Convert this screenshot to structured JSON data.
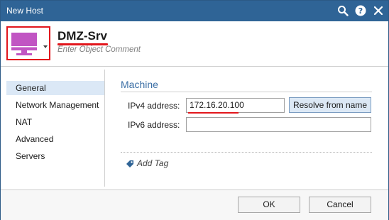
{
  "window": {
    "title": "New Host",
    "icons": [
      "search-icon",
      "help-icon",
      "close-icon"
    ]
  },
  "object": {
    "name": "DMZ-Srv",
    "comment_placeholder": "Enter Object Comment",
    "icon": "host-monitor-icon",
    "icon_color": "#c155c3"
  },
  "sidebar": {
    "items": [
      {
        "label": "General",
        "selected": true
      },
      {
        "label": "Network Management",
        "selected": false
      },
      {
        "label": "NAT",
        "selected": false
      },
      {
        "label": "Advanced",
        "selected": false
      },
      {
        "label": "Servers",
        "selected": false
      }
    ]
  },
  "main": {
    "section_title": "Machine",
    "ipv4": {
      "label": "IPv4 address:",
      "value": "172.16.20.100"
    },
    "ipv6": {
      "label": "IPv6 address:",
      "value": ""
    },
    "resolve_label": "Resolve from name",
    "add_tag_label": "Add Tag"
  },
  "footer": {
    "ok_label": "OK",
    "cancel_label": "Cancel"
  },
  "colors": {
    "titlebar": "#2f6496",
    "highlight": "#e2161c",
    "accent": "#3a6ea5",
    "selected_nav": "#dbe8f6"
  }
}
